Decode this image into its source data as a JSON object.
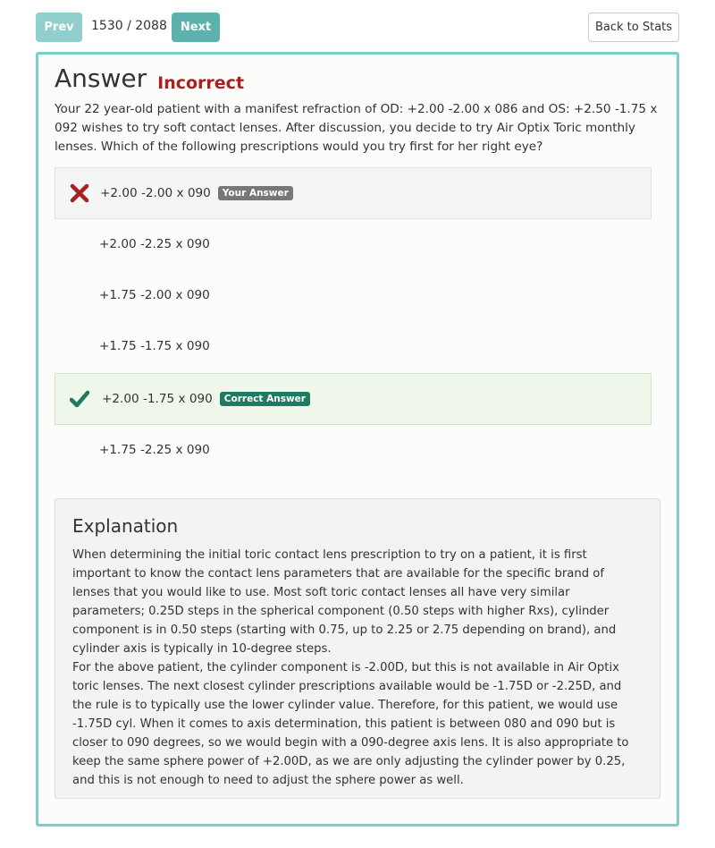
{
  "nav": {
    "prev_label": "Prev",
    "next_label": "Next",
    "counter": "1530 / 2088",
    "back_label": "Back to Stats"
  },
  "answer": {
    "title": "Answer",
    "status": "Incorrect",
    "status_color": "#a82020"
  },
  "question": "Your 22 year-old patient with a manifest refraction of OD: +2.00 -2.00 x 086 and OS: +2.50 -1.75 x 092 wishes to try soft contact lenses. After discussion, you decide to try Air Optix Toric monthly lenses. Which of the following prescriptions would you try first for her right eye?",
  "choices": [
    {
      "text": "+2.00 -2.00 x 090",
      "badge": "Your Answer",
      "state": "wrong",
      "icon": "x-icon"
    },
    {
      "text": "+2.00 -2.25 x 090"
    },
    {
      "text": "+1.75 -2.00 x 090"
    },
    {
      "text": "+1.75 -1.75 x 090"
    },
    {
      "text": "+2.00 -1.75 x 090",
      "badge": "Correct Answer",
      "state": "right",
      "icon": "check-icon"
    },
    {
      "text": "+1.75 -2.25 x 090"
    }
  ],
  "explanation": {
    "title": "Explanation",
    "paragraphs": [
      "When determining the initial toric contact lens prescription to try on a patient, it is first important to know the contact lens parameters that are available for the specific brand of lenses that you would like to use. Most soft toric contact lenses all have very similar parameters; 0.25D steps in the spherical component (0.50 steps with higher Rxs), cylinder component is in 0.50 steps (starting with 0.75, up to 2.25 or 2.75 depending on brand), and cylinder axis is typically in 10-degree steps.",
      "For the above patient, the cylinder component is -2.00D, but this is not available in Air Optix toric lenses. The next closest cylinder prescriptions available would be -1.75D or -2.25D, and the rule is to typically use the lower cylinder value. Therefore, for this patient, we would use -1.75D cyl. When it comes to axis determination, this patient is between 080 and 090 but is closer to 090 degrees, so we would begin with a 090-degree axis lens. It is also appropriate to keep the same sphere power of +2.00D, as we are only adjusting the cylinder power by 0.25, and this is not enough to need to adjust the sphere power as well."
    ]
  },
  "colors": {
    "accent": "#5cb3ae",
    "card_border": "#7ccfc9",
    "wrong_icon": "#a82020",
    "correct_icon": "#1f7a63"
  }
}
